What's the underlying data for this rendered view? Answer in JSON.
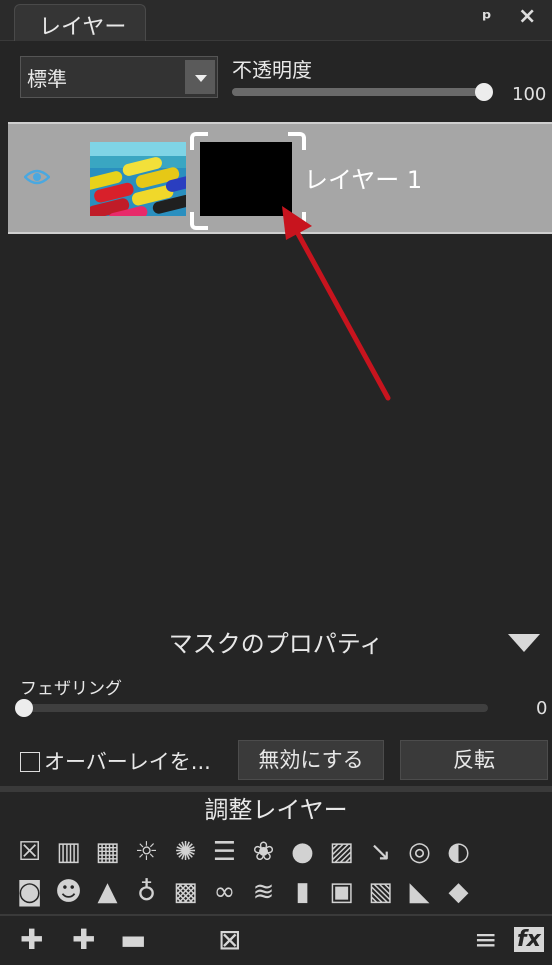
{
  "tab": {
    "label": "レイヤー"
  },
  "window_controls": {
    "pin": "ꟼ",
    "close": "✕"
  },
  "blend_mode": {
    "value": "標準"
  },
  "opacity": {
    "label": "不透明度",
    "value": "100",
    "level": 1.0
  },
  "layer": {
    "name": "レイヤー 1"
  },
  "mask_properties": {
    "title": "マスクのプロパティ",
    "feathering_label": "フェザリング",
    "feathering_value": "0",
    "feathering_level": 0,
    "overlay_label": "オーバーレイを...",
    "disable_button": "無効にする",
    "invert_button": "反転"
  },
  "adjustment": {
    "title": "調整レイヤー",
    "row1": [
      "☒",
      "▥",
      "▦",
      "☼",
      "✺",
      "☰",
      "❀",
      "●",
      "▨",
      "↘",
      "◎",
      "◐"
    ],
    "row2": [
      "◙",
      "☻",
      "▲",
      "♁",
      "▩",
      "∞",
      "≋",
      "▮",
      "▣",
      "▧",
      "◣",
      "◆"
    ]
  },
  "bottom": {
    "new_layer": "✚",
    "add": "✚",
    "group": "▬",
    "delete_mask": "⊠",
    "menu": "≡",
    "fx": "fx"
  },
  "colors": {
    "annotation_arrow": "#c8141e",
    "eye_icon": "#4aa8e0"
  }
}
